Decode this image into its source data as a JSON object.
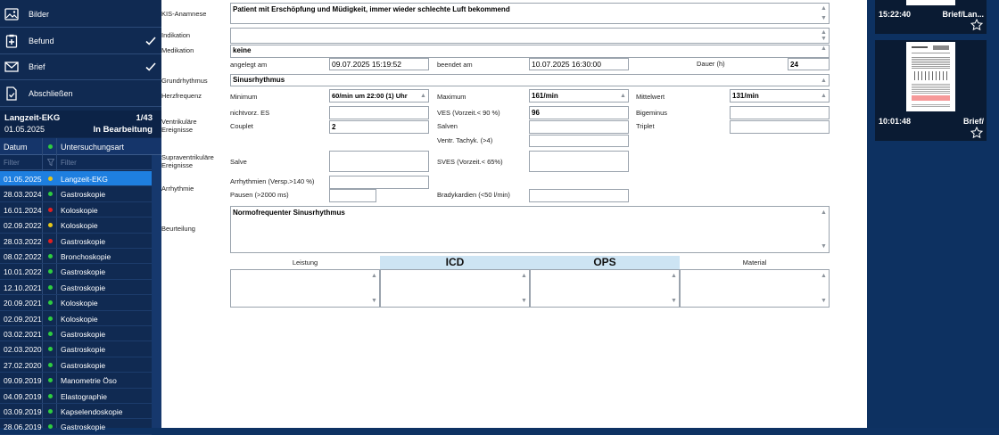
{
  "sidebar": {
    "nav": [
      {
        "label": "Bilder",
        "icon": "image-icon",
        "checked": false
      },
      {
        "label": "Befund",
        "icon": "clipboard-plus-icon",
        "checked": true
      },
      {
        "label": "Brief",
        "icon": "envelope-icon",
        "checked": true
      },
      {
        "label": "Abschließen",
        "icon": "document-check-icon",
        "checked": false
      }
    ],
    "exam": {
      "title": "Langzeit-EKG",
      "date": "01.05.2025",
      "counter": "1/43",
      "status": "In Bearbeitung"
    },
    "table": {
      "headers": [
        "Datum",
        "Untersuchungsart"
      ],
      "filter_placeholder": "Filter",
      "rows": [
        {
          "date": "01.05.2025",
          "status_color": "#e6c619",
          "type": "Langzeit-EKG",
          "selected": true
        },
        {
          "date": "28.03.2024",
          "status_color": "#2ecc40",
          "type": "Gastroskopie"
        },
        {
          "date": "16.01.2024",
          "status_color": "#e02020",
          "type": "Koloskopie"
        },
        {
          "date": "02.09.2022",
          "status_color": "#e6c619",
          "type": "Koloskopie"
        },
        {
          "date": "28.03.2022",
          "status_color": "#e02020",
          "type": "Gastroskopie"
        },
        {
          "date": "08.02.2022",
          "status_color": "#2ecc40",
          "type": "Bronchoskopie"
        },
        {
          "date": "10.01.2022",
          "status_color": "#2ecc40",
          "type": "Gastroskopie"
        },
        {
          "date": "12.10.2021",
          "status_color": "#2ecc40",
          "type": "Gastroskopie"
        },
        {
          "date": "20.09.2021",
          "status_color": "#2ecc40",
          "type": "Koloskopie"
        },
        {
          "date": "02.09.2021",
          "status_color": "#2ecc40",
          "type": "Koloskopie"
        },
        {
          "date": "03.02.2021",
          "status_color": "#2ecc40",
          "type": "Gastroskopie"
        },
        {
          "date": "02.03.2020",
          "status_color": "#2ecc40",
          "type": "Gastroskopie"
        },
        {
          "date": "27.02.2020",
          "status_color": "#2ecc40",
          "type": "Gastroskopie"
        },
        {
          "date": "09.09.2019",
          "status_color": "#2ecc40",
          "type": "Manometrie Öso"
        },
        {
          "date": "04.09.2019",
          "status_color": "#2ecc40",
          "type": "Elastographie"
        },
        {
          "date": "03.09.2019",
          "status_color": "#2ecc40",
          "type": "Kapselendoskopie"
        },
        {
          "date": "28.06.2019",
          "status_color": "#2ecc40",
          "type": "Gastroskopie"
        }
      ]
    }
  },
  "form": {
    "kis_label": "KIS-Anamnese",
    "kis_value": "Patient mit Erschöpfung und Müdigkeit, immer wieder schlechte Luft bekommend",
    "indikation_label": "Indikation",
    "indikation_value": "",
    "medikation_label": "Medikation",
    "medikation_value": "keine",
    "angelegt_label": "angelegt am",
    "angelegt_value": "09.07.2025 15:19:52",
    "beendet_label": "beendet am",
    "beendet_value": "10.07.2025 16:30:00",
    "dauer_label": "Dauer (h)",
    "dauer_value": "24",
    "grundrhythmus_label": "Grundrhythmus",
    "grundrhythmus_value": "Sinusrhythmus",
    "herzfrequenz_label": "Herzfrequenz",
    "minimum_label": "Minimum",
    "minimum_value": "60/min um 22:00 (1) Uhr",
    "maximum_label": "Maximum",
    "maximum_value": "161/min",
    "mittelwert_label": "Mittelwert",
    "mittelwert_value": "131/min",
    "ventrikulaere_label": "Ventrikuläre Ereignisse",
    "nichtvorz_label": "nichtvorz. ES",
    "nichtvorz_value": "",
    "ves_label": "VES (Vorzeit.< 90 %)",
    "ves_value": "96",
    "bigeminus_label": "Bigeminus",
    "bigeminus_value": "",
    "couplet_label": "Couplet",
    "couplet_value": "2",
    "salven_label": "Salven",
    "salven_value": "",
    "triplet_label": "Triplet",
    "triplet_value": "",
    "tachyk_label": "Ventr. Tachyk. (>4)",
    "tachyk_value": "",
    "supra_label": "Supraventrikuläre Ereignisse",
    "salve_label": "Salve",
    "salve_value": "",
    "sves_label": "SVES (Vorzeit.< 65%)",
    "sves_value": "",
    "arrhythmie_label": "Arrhythmie",
    "arrhythmien_label": "Arrhythmien (Versp.>140 %)",
    "arrhythmien_value": "",
    "pausen_label": "Pausen (>2000 ms)",
    "pausen_value": "",
    "brady_label": "Bradykardien (<50 l/min)",
    "brady_value": "",
    "beurteilung_label": "Beurteilung",
    "beurteilung_value": "Normofrequenter Sinusrhythmus",
    "tabs": [
      "Leistung",
      "ICD",
      "OPS",
      "Material"
    ]
  },
  "right_panel": {
    "tiles": [
      {
        "time": "15:22:40",
        "kind": "Brief/Lan..."
      },
      {
        "time": "10:01:48",
        "kind": "Brief/"
      }
    ]
  }
}
